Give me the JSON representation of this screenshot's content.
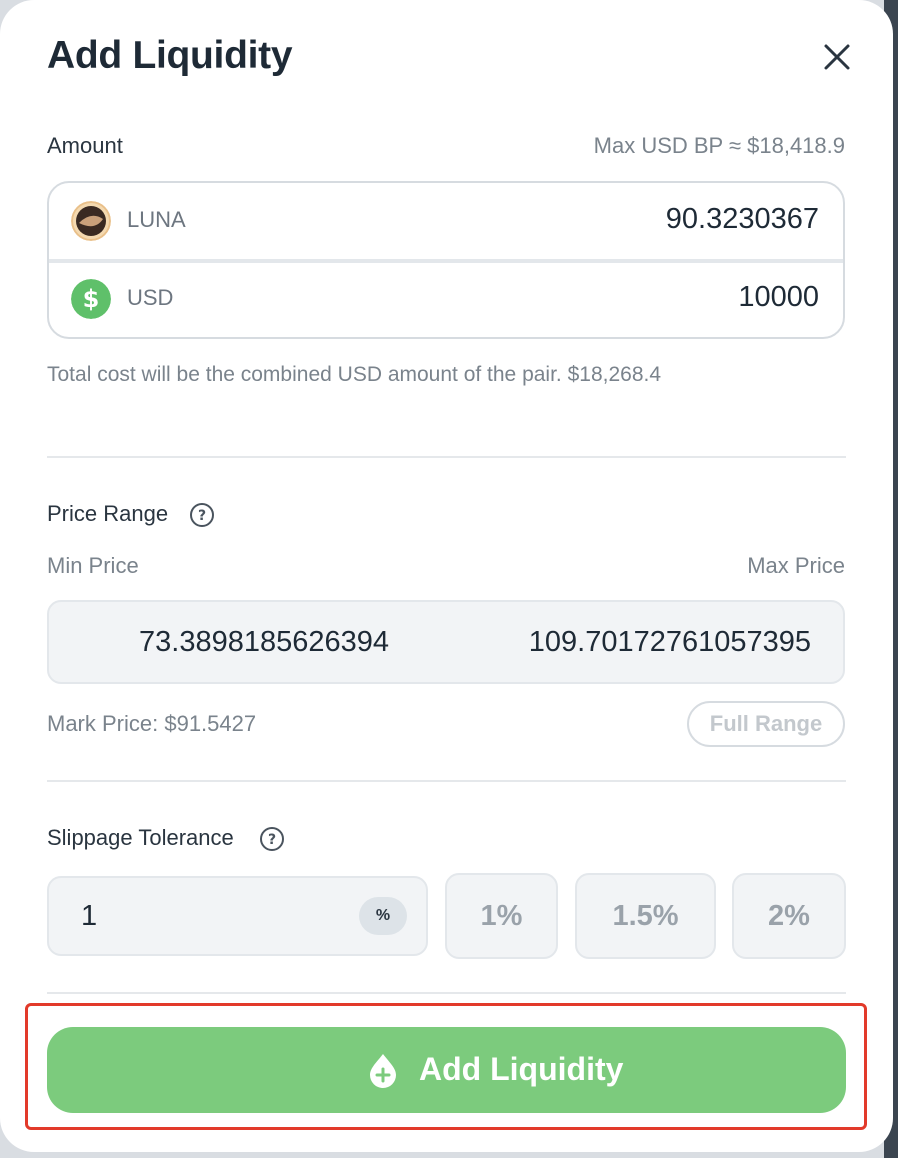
{
  "modal": {
    "title": "Add Liquidity"
  },
  "amount": {
    "label": "Amount",
    "max_bp": "Max USD BP ≈ $18,418.9",
    "tokens": [
      {
        "name": "LUNA",
        "value": "90.3230367",
        "icon": "luna-icon"
      },
      {
        "name": "USD",
        "value": "10000",
        "icon": "dollar-icon"
      }
    ],
    "total_cost": "Total cost will be the combined USD amount of the pair. $18,268.4"
  },
  "price_range": {
    "label": "Price Range",
    "min_label": "Min Price",
    "max_label": "Max Price",
    "min_value": "73.3898185626394",
    "max_value": "109.70172761057395",
    "mark_price": "Mark Price: $91.5427",
    "full_range_label": "Full Range"
  },
  "slippage": {
    "label": "Slippage Tolerance",
    "value": "1",
    "unit": "%",
    "presets": [
      "1%",
      "1.5%",
      "2%"
    ]
  },
  "submit": {
    "label": "Add Liquidity",
    "icon": "drop-plus-icon"
  },
  "colors": {
    "primary_green": "#7ccb7d",
    "highlight_red": "#e23a2a",
    "title": "#1e2a36"
  }
}
